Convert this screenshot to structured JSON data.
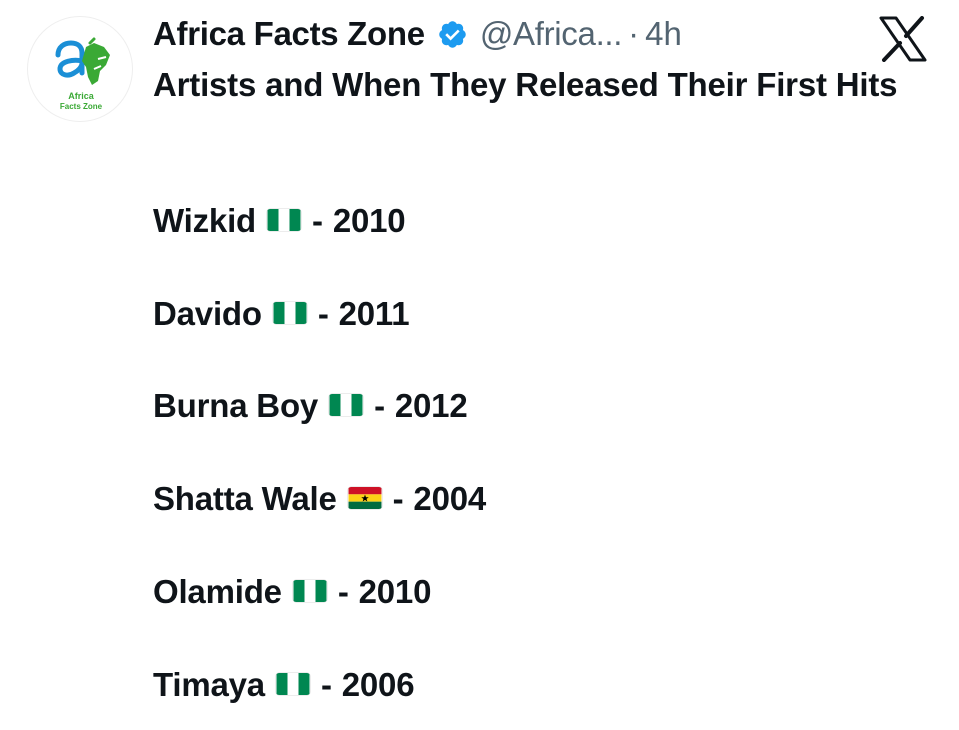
{
  "tweet": {
    "display_name": "Africa Facts Zone",
    "handle": "@Africa...",
    "separator": "·",
    "time": "4h",
    "verified_icon": "verified-badge-icon",
    "platform_icon": "x-logo-icon",
    "avatar_text": [
      "Africa",
      "Facts Zone"
    ],
    "title": "Artists and When They Released Their First Hits",
    "entries": [
      {
        "name": "Wizkid",
        "flag": "nigeria-flag-icon",
        "dash": "-",
        "year": "2010"
      },
      {
        "name": "Davido",
        "flag": "nigeria-flag-icon",
        "dash": "-",
        "year": "2011"
      },
      {
        "name": "Burna Boy",
        "flag": "nigeria-flag-icon",
        "dash": "-",
        "year": "2012"
      },
      {
        "name": "Shatta Wale",
        "flag": "ghana-flag-icon",
        "dash": "-",
        "year": "2004"
      },
      {
        "name": "Olamide",
        "flag": "nigeria-flag-icon",
        "dash": "-",
        "year": "2010"
      },
      {
        "name": "Timaya",
        "flag": "nigeria-flag-icon",
        "dash": "-",
        "year": "2006"
      }
    ]
  },
  "colors": {
    "text": "#0f1419",
    "secondary": "#536471",
    "verified": "#1d9bf0",
    "brand_green": "#3aa935",
    "brand_blue": "#1b8fd6",
    "nigeria_green": "#008751",
    "ghana_red": "#ce1126",
    "ghana_gold": "#fcd116",
    "ghana_green": "#006b3f"
  }
}
